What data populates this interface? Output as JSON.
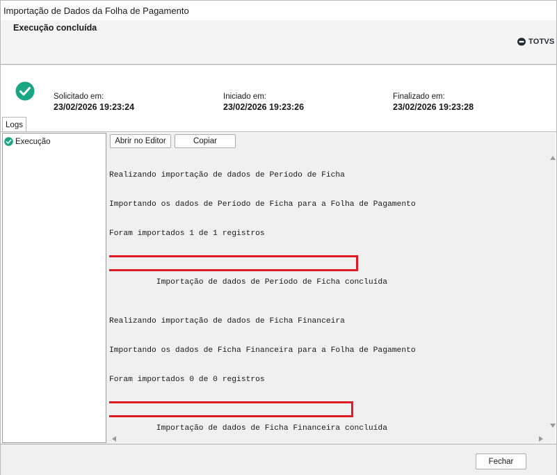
{
  "window": {
    "title": "Importação de Dados da Folha de Pagamento"
  },
  "header": {
    "title": "Execução concluída",
    "logo_text": "TOTVS"
  },
  "summary": {
    "status_icon": "check-circle-icon",
    "requested_label": "Solicitado em:",
    "requested_value": "23/02/2026 19:23:24",
    "started_label": "Iniciado em:",
    "started_value": "23/02/2026 19:23:26",
    "finished_label": "Finalizado em:",
    "finished_value": "23/02/2026 19:23:28"
  },
  "tabs": [
    {
      "label": "Logs"
    }
  ],
  "tree": {
    "items": [
      {
        "label": "Execução",
        "icon": "check-circle-icon"
      }
    ]
  },
  "toolbar": {
    "open_editor_label": "Abrir no Editor",
    "copy_label": "Copiar"
  },
  "log": {
    "lines": [
      "Realizando importação de dados de Período de Ficha",
      "Importando os dados de Período de Ficha para a Folha de Pagamento",
      "Foram importados 1 de 1 registros",
      "Importação de dados de Período de Ficha concluída",
      "",
      "Realizando importação de dados de Ficha Financeira",
      "Importando os dados de Ficha Financeira para a Folha de Pagamento",
      "Foram importados 0 de 0 registros",
      "Importação de dados de Ficha Financeira concluída"
    ],
    "highlight_color": "#e01b24"
  },
  "footer": {
    "close_label": "Fechar"
  },
  "colors": {
    "success": "#1aa585",
    "highlight": "#e01b24"
  }
}
